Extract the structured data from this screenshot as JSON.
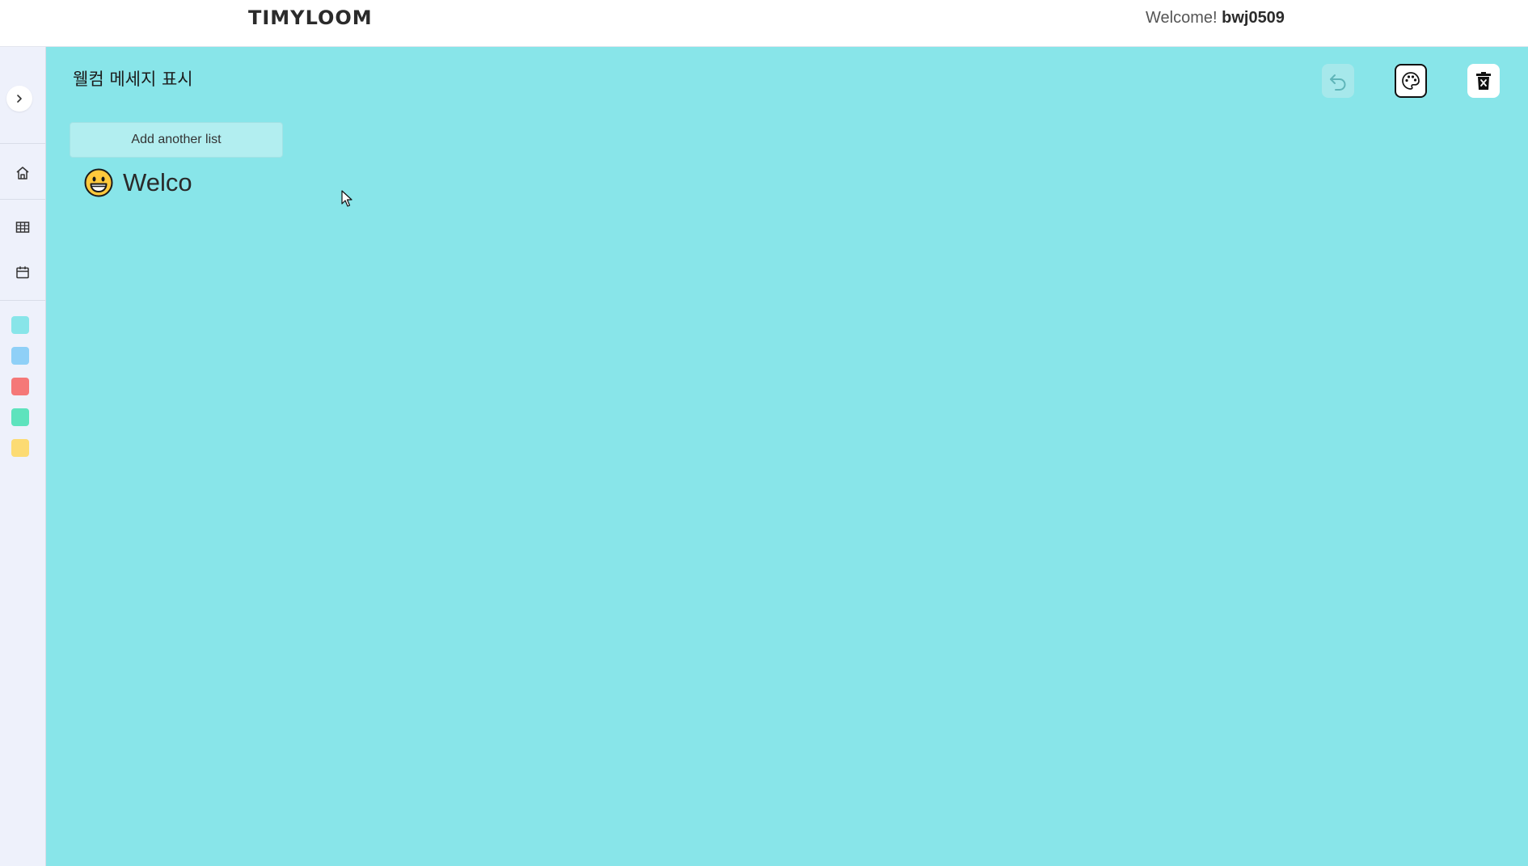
{
  "header": {
    "logo": "TIMYLOOM",
    "welcome_prefix": "Welcome! ",
    "username": "bwj0509"
  },
  "sidebar": {
    "expand_icon": "chevron-right-icon",
    "nav": [
      {
        "name": "home",
        "icon": "home-icon"
      },
      {
        "name": "table",
        "icon": "table-icon"
      },
      {
        "name": "calendar",
        "icon": "calendar-icon"
      }
    ],
    "swatches": [
      {
        "name": "cyan",
        "color": "#88e5e9"
      },
      {
        "name": "blue",
        "color": "#8fd0f7"
      },
      {
        "name": "red",
        "color": "#f57878"
      },
      {
        "name": "green",
        "color": "#5ee3bd"
      },
      {
        "name": "yellow",
        "color": "#fcdb73"
      }
    ]
  },
  "board": {
    "title": "웰컴 메세지 표시",
    "background": "#88e5e9",
    "toolbar": {
      "undo_icon": "undo-icon",
      "theme_icon": "palette-icon",
      "delete_icon": "trash-icon"
    },
    "add_list_label": "Add another list",
    "welcome_message": "Welco",
    "welcome_emoji": "grinning-face-emoji"
  }
}
